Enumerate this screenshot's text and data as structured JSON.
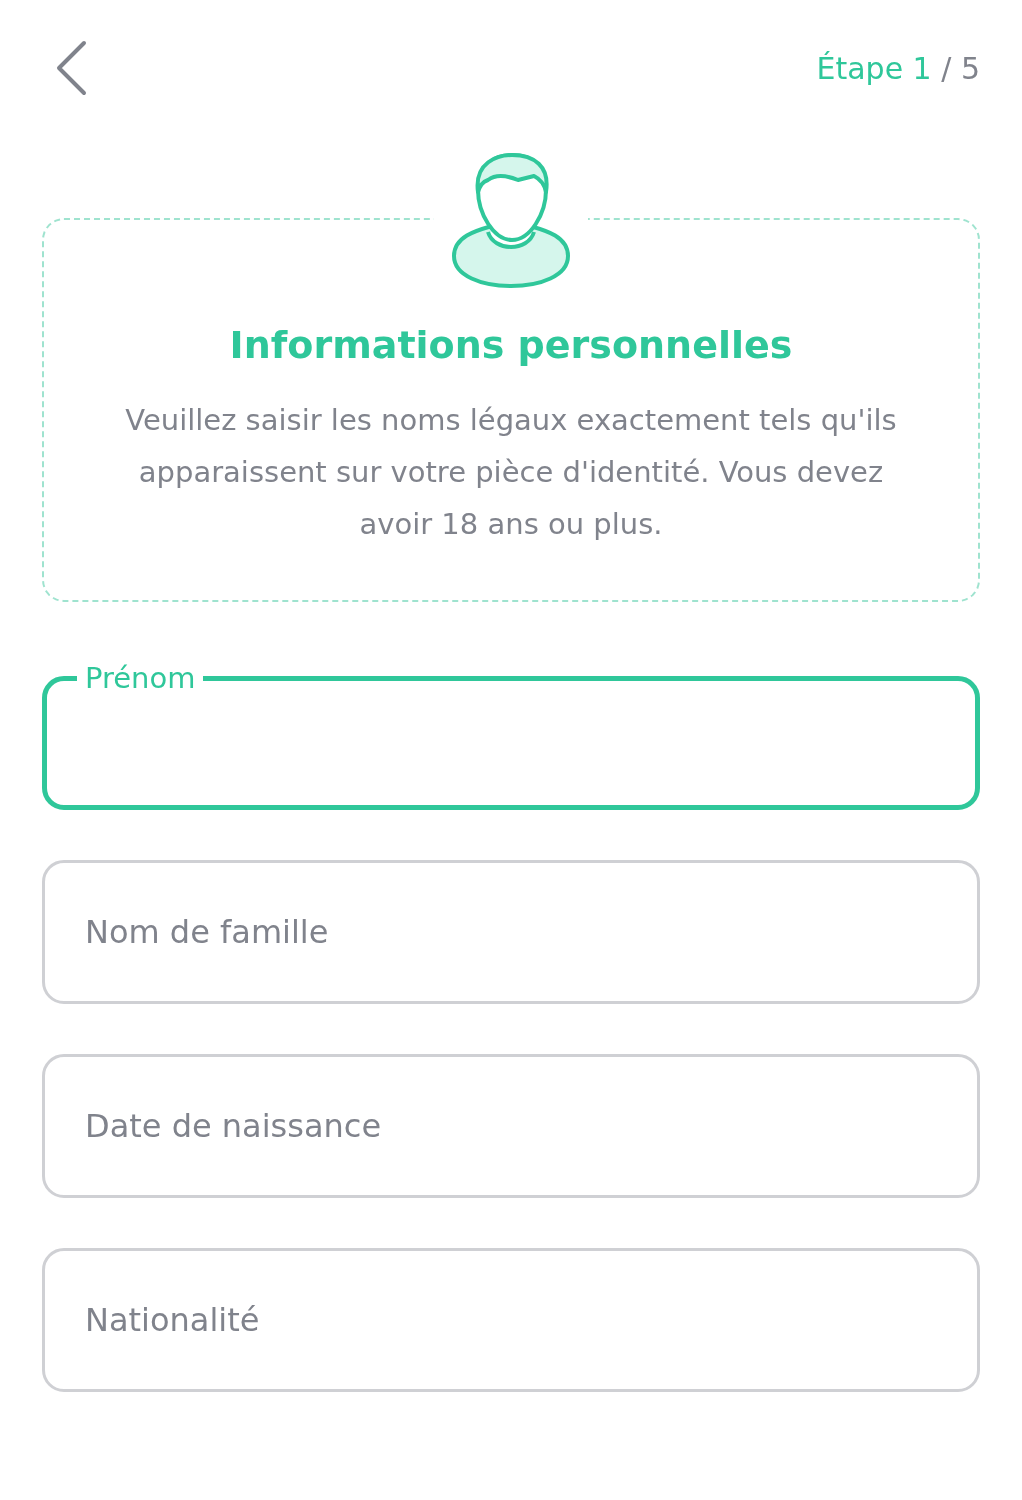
{
  "header": {
    "step_label": "Étape 1",
    "step_total": "/ 5"
  },
  "intro": {
    "title": "Informations personnelles",
    "text": "Veuillez saisir les noms légaux exactement tels qu'ils apparaissent sur votre pièce d'identité. Vous devez avoir 18 ans ou plus."
  },
  "fields": [
    {
      "label": "Prénom",
      "focused": true
    },
    {
      "placeholder": "Nom de famille",
      "focused": false
    },
    {
      "placeholder": "Date de naissance",
      "focused": false
    },
    {
      "placeholder": "Nationalité",
      "focused": false
    }
  ]
}
